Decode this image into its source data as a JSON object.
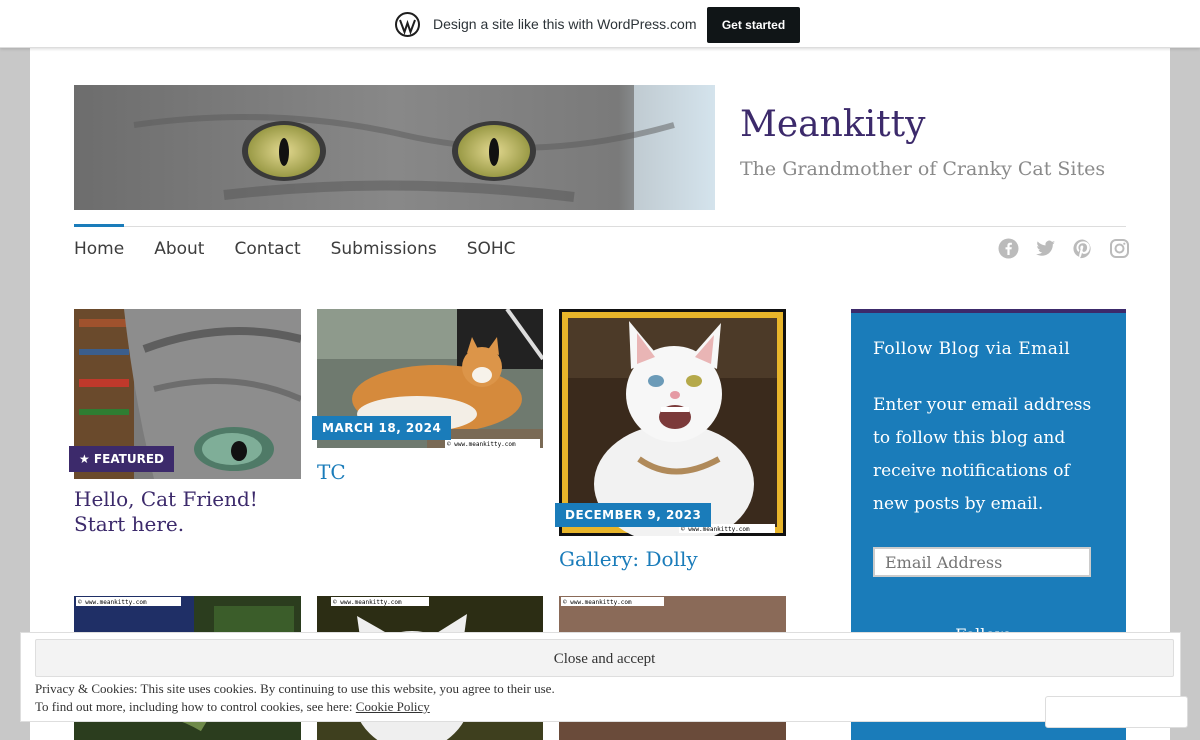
{
  "wpbar": {
    "promo": "Design a site like this with WordPress.com",
    "cta": "Get started"
  },
  "site": {
    "title": "Meankitty",
    "tagline": "The Grandmother of Cranky Cat Sites"
  },
  "nav": {
    "items": [
      "Home",
      "About",
      "Contact",
      "Submissions",
      "SOHC"
    ],
    "active": "Home"
  },
  "social": [
    "facebook-icon",
    "twitter-icon",
    "pinterest-icon",
    "instagram-icon"
  ],
  "posts": [
    {
      "title": "Hello, Cat Friend! Start here.",
      "badge": "★ FEATURED"
    },
    {
      "title": "TC",
      "date": "MARCH 18, 2024"
    },
    {
      "title": "Gallery: Dolly",
      "date": "DECEMBER 9, 2023"
    }
  ],
  "watermark": "© www.meankitty.com",
  "sidebar": {
    "widget_title": "Follow Blog via Email",
    "widget_text": "Enter your email address to follow this blog and receive notifications of new posts by email.",
    "email_placeholder": "Email Address",
    "follow_label": "Follow"
  },
  "cookie": {
    "close_label": "Close and accept",
    "line1": "Privacy & Cookies: This site uses cookies. By continuing to use this website, you agree to their use.",
    "line2_prefix": "To find out more, including how to control cookies, see here:",
    "policy_link": "Cookie Policy"
  },
  "colors": {
    "accent": "#1a7cba",
    "brand_purple": "#3c2a6b"
  }
}
